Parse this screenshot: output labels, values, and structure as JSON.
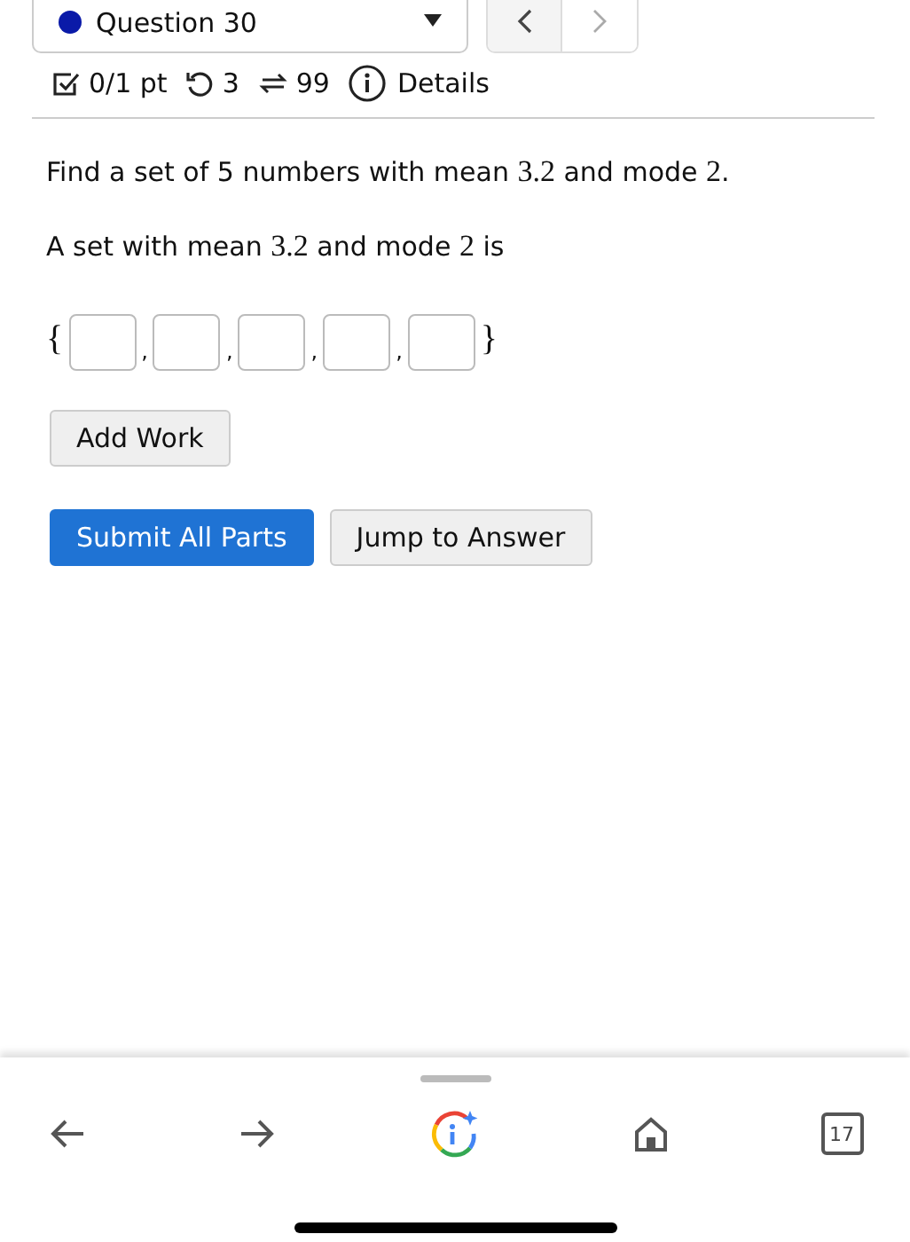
{
  "question_selector": {
    "label": "Question 30"
  },
  "meta": {
    "score": "0/1 pt",
    "retries": "3",
    "attempts": "99",
    "details": "Details"
  },
  "prompt": [
    {
      "kind": "text",
      "text": "Find a set of 5 numbers with mean "
    },
    {
      "kind": "math",
      "text": "3.2"
    },
    {
      "kind": "text",
      "text": " and mode "
    },
    {
      "kind": "math",
      "text": "2"
    },
    {
      "kind": "text",
      "text": "."
    }
  ],
  "answer_prompt": [
    {
      "kind": "text",
      "text": "A set with mean "
    },
    {
      "kind": "math",
      "text": "3.2"
    },
    {
      "kind": "text",
      "text": " and mode "
    },
    {
      "kind": "math",
      "text": "2"
    },
    {
      "kind": "text",
      "text": " is"
    }
  ],
  "answer_set": {
    "open": "{",
    "close": "}",
    "separator": ",",
    "blanks": [
      {
        "kind": "input"
      },
      {
        "kind": "input"
      },
      {
        "kind": "input"
      },
      {
        "kind": "input"
      },
      {
        "kind": "input"
      }
    ]
  },
  "add_work_button": "Add Work",
  "buttons": [
    {
      "label": "Submit All Parts",
      "kind": "primary"
    },
    {
      "label": "Jump to Answer",
      "kind": "secondary"
    }
  ],
  "browser_toolbar": {
    "tab_count": "17"
  }
}
